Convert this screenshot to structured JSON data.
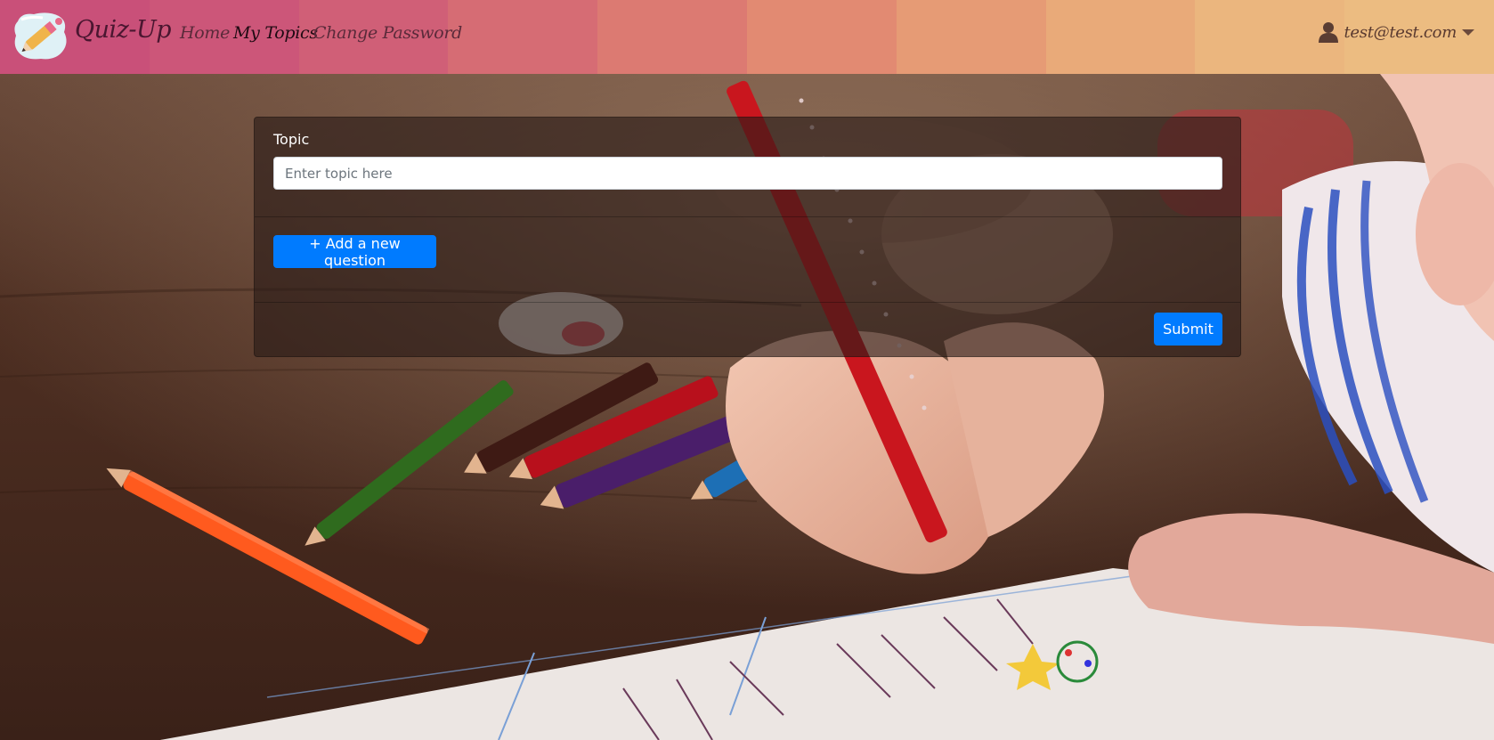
{
  "app": {
    "brand": "Quiz-Up",
    "accent_color": "#007bff"
  },
  "navbar": {
    "links": [
      {
        "label": "Home"
      },
      {
        "label": "My Topics",
        "active": true
      },
      {
        "label": "Change Password"
      }
    ],
    "user": {
      "email": "test@test.com",
      "icon": "user-icon"
    },
    "gradient_colors": [
      "#c95079",
      "#cc5679",
      "#d05f77",
      "#d66c74",
      "#dc7a72",
      "#e28a72",
      "#e69b75",
      "#e9aa79",
      "#ebb67e",
      "#ecbc81"
    ]
  },
  "form": {
    "topic_label": "Topic",
    "topic_placeholder": "Enter topic here",
    "topic_value": "",
    "add_question_label": "+ Add a new question",
    "submit_label": "Submit"
  }
}
